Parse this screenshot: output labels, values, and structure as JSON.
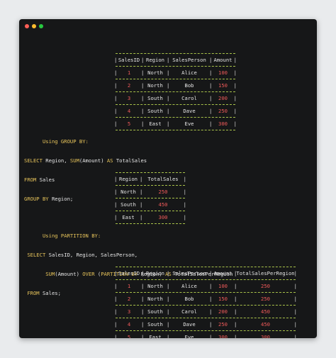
{
  "window": {
    "dots": [
      "close",
      "minimize",
      "maximize"
    ]
  },
  "table1": {
    "headers": [
      "SalesID",
      "Region",
      "SalesPerson",
      "Amount"
    ],
    "rows": [
      [
        "1",
        "North",
        "Alice",
        "100"
      ],
      [
        "2",
        "North",
        "Bob",
        "150"
      ],
      [
        "3",
        "South",
        "Carol",
        "200"
      ],
      [
        "4",
        "South",
        "Dave",
        "250"
      ],
      [
        "5",
        "East",
        "Eve",
        "300"
      ]
    ]
  },
  "group_by": {
    "label": "Using GROUP BY:",
    "line1": {
      "kw1": "SELECT",
      "t1": " Region, ",
      "fn": "SUM",
      "t2": "(Amount) ",
      "kw2": "AS",
      "t3": " TotalSales"
    },
    "line2": {
      "kw": "FROM",
      "t": " Sales"
    },
    "line3": {
      "kw": "GROUP BY",
      "t": " Region;"
    }
  },
  "table2": {
    "headers": [
      "Region",
      "TotalSales"
    ],
    "rows": [
      [
        "North",
        "250"
      ],
      [
        "South",
        "450"
      ],
      [
        "East",
        "300"
      ]
    ]
  },
  "partition_by": {
    "label": "Using PARTITION BY:",
    "line1": {
      "kw": "SELECT",
      "t": " SalesID, Region, SalesPerson,"
    },
    "line2": {
      "fn": "SUM",
      "t1": "(Amount) ",
      "kw1": "OVER",
      "t2": " (",
      "kw2": "PARTITION BY",
      "t3": " Region) ",
      "kw3": "AS",
      "t4": " TotalSalesPerRegion"
    },
    "line3": {
      "kw": "FROM",
      "t": " Sales;"
    }
  },
  "table3": {
    "headers": [
      "SalesID",
      "Region",
      "SalesPerson",
      "Amount",
      "TotalSalesPerRegion"
    ],
    "rows": [
      [
        "1",
        "North",
        "Alice",
        "100",
        "250"
      ],
      [
        "2",
        "North",
        "Bob",
        "150",
        "250"
      ],
      [
        "3",
        "South",
        "Carol",
        "200",
        "450"
      ],
      [
        "4",
        "South",
        "Dave",
        "250",
        "450"
      ],
      [
        "5",
        "East",
        "Eve",
        "300",
        "300"
      ]
    ]
  }
}
